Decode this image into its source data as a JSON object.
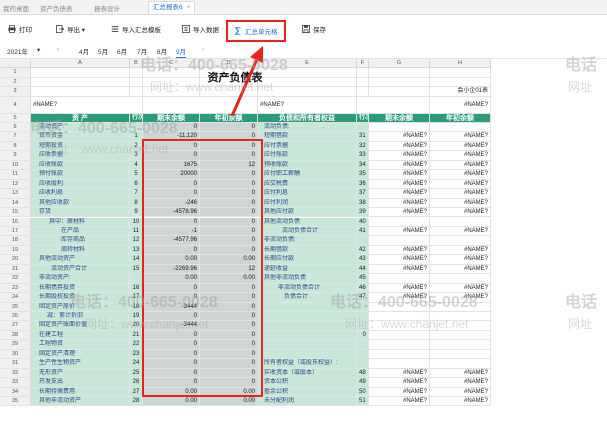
{
  "tabs": [
    "我的桌面",
    "资产负债表",
    "报表设计",
    "汇总报表6"
  ],
  "toolbar": {
    "print": "打印",
    "export": "导出",
    "import_template": "导入汇总模板",
    "import_data": "导入数据",
    "summarize_cells": "汇总单元格",
    "save": "保存"
  },
  "period": {
    "year": "2021年",
    "months": [
      "4月",
      "5月",
      "6月",
      "7月",
      "8月",
      "9月"
    ],
    "active_index": 5
  },
  "sheet": {
    "col_headers": [
      "A",
      "B",
      "C",
      "D",
      "E",
      "F",
      "G",
      "H"
    ],
    "title": "资产负债表",
    "unit": "会小企01表",
    "name_left": "#NAME?",
    "name_mid": "#NAME?",
    "name_right": "#NAME?",
    "header_left": [
      "资 产",
      "行次",
      "期末余额",
      "年初余额"
    ],
    "header_right": [
      "负债和所有者权益",
      "行次",
      "期末余额",
      "年初余额"
    ],
    "rows": [
      {
        "r": "6",
        "a": "流动资产:",
        "b": "",
        "c": "0",
        "d": "0",
        "e": "流动负债:",
        "f": "",
        "g": "",
        "h": ""
      },
      {
        "r": "7",
        "a": "货币资金",
        "b": "1",
        "c": "-11,120",
        "d": "0",
        "e": "短期借款",
        "f": "31",
        "g": "#NAME?",
        "h": "#NAME?"
      },
      {
        "r": "8",
        "a": "短期投资",
        "b": "2",
        "c": "0",
        "d": "0",
        "e": "应付票据",
        "f": "32",
        "g": "#NAME?",
        "h": "#NAME?"
      },
      {
        "r": "9",
        "a": "应收票据",
        "b": "3",
        "c": "0",
        "d": "0",
        "e": "应付账款",
        "f": "33",
        "g": "#NAME?",
        "h": "#NAME?"
      },
      {
        "r": "10",
        "a": "应收账款",
        "b": "4",
        "c": "1675",
        "d": "12",
        "e": "预收账款",
        "f": "34",
        "g": "#NAME?",
        "h": "#NAME?"
      },
      {
        "r": "11",
        "a": "预付账款",
        "b": "5",
        "c": "20000",
        "d": "0",
        "e": "应付职工薪酬",
        "f": "35",
        "g": "#NAME?",
        "h": "#NAME?"
      },
      {
        "r": "12",
        "a": "应收股利",
        "b": "6",
        "c": "0",
        "d": "0",
        "e": "应交税费",
        "f": "36",
        "g": "#NAME?",
        "h": "#NAME?"
      },
      {
        "r": "13",
        "a": "应收利息",
        "b": "7",
        "c": "0",
        "d": "0",
        "e": "应付利息",
        "f": "37",
        "g": "#NAME?",
        "h": "#NAME?"
      },
      {
        "r": "14",
        "a": "其他应收款",
        "b": "8",
        "c": "-246",
        "d": "0",
        "e": "应付利润",
        "f": "38",
        "g": "#NAME?",
        "h": "#NAME?"
      },
      {
        "r": "15",
        "a": "存货",
        "b": "9",
        "c": "-4578.96",
        "d": "0",
        "e": "其他应付款",
        "f": "39",
        "g": "#NAME?",
        "h": "#NAME?"
      },
      {
        "r": "16",
        "a": "其中：原材料",
        "b": "10",
        "c": "0",
        "d": "0",
        "e": "其他流动负债",
        "f": "40",
        "g": "",
        "h": ""
      },
      {
        "r": "17",
        "a": "在产品",
        "b": "11",
        "c": "-1",
        "d": "0",
        "e": "流动负债合计",
        "f": "41",
        "g": "#NAME?",
        "h": "#NAME?"
      },
      {
        "r": "18",
        "a": "库存商品",
        "b": "12",
        "c": "-4577.96",
        "d": "0",
        "e": "非流动负债:",
        "f": "",
        "g": "",
        "h": ""
      },
      {
        "r": "19",
        "a": "周转材料",
        "b": "13",
        "c": "0",
        "d": "0",
        "e": "长期借款",
        "f": "42",
        "g": "#NAME?",
        "h": "#NAME?"
      },
      {
        "r": "20",
        "a": "其他流动资产",
        "b": "14",
        "c": "0.00",
        "d": "0.00",
        "e": "长期应付款",
        "f": "43",
        "g": "#NAME?",
        "h": "#NAME?"
      },
      {
        "r": "21",
        "a": "流动资产合计",
        "b": "15",
        "c": "-2269.96",
        "d": "12",
        "e": "递延收益",
        "f": "44",
        "g": "#NAME?",
        "h": "#NAME?"
      },
      {
        "r": "22",
        "a": "非流动资产:",
        "b": "",
        "c": "0.00",
        "d": "0.00",
        "e": "其他非流动负债",
        "f": "45",
        "g": "",
        "h": ""
      },
      {
        "r": "23",
        "a": "长期债券投资",
        "b": "16",
        "c": "0",
        "d": "0",
        "e": "非流动负债合计",
        "f": "46",
        "g": "#NAME?",
        "h": "#NAME?"
      },
      {
        "r": "24",
        "a": "长期股权投资",
        "b": "17",
        "c": "0",
        "d": "0",
        "e": "负债合计",
        "f": "47",
        "g": "#NAME?",
        "h": "#NAME?"
      },
      {
        "r": "25",
        "a": "固定资产原价",
        "b": "18",
        "c": "-3444",
        "d": "0",
        "e": "",
        "f": "",
        "g": "",
        "h": ""
      },
      {
        "r": "26",
        "a": "减：累计折旧",
        "b": "19",
        "c": "0",
        "d": "0",
        "e": "",
        "f": "",
        "g": "",
        "h": ""
      },
      {
        "r": "27",
        "a": "固定资产账面价值",
        "b": "20",
        "c": "-3444",
        "d": "0",
        "e": "",
        "f": "",
        "g": "",
        "h": ""
      },
      {
        "r": "28",
        "a": "在建工程",
        "b": "21",
        "c": "0",
        "d": "0",
        "e": "",
        "f": "0",
        "g": "",
        "h": ""
      },
      {
        "r": "29",
        "a": "工程物资",
        "b": "22",
        "c": "0",
        "d": "0",
        "e": "",
        "f": "",
        "g": "",
        "h": ""
      },
      {
        "r": "30",
        "a": "固定资产清理",
        "b": "23",
        "c": "0",
        "d": "0",
        "e": "",
        "f": "",
        "g": "",
        "h": ""
      },
      {
        "r": "31",
        "a": "生产性生物资产",
        "b": "24",
        "c": "0",
        "d": "0",
        "e": "所有者权益（或股东权益）:",
        "f": "",
        "g": "",
        "h": ""
      },
      {
        "r": "32",
        "a": "无形资产",
        "b": "25",
        "c": "0",
        "d": "0",
        "e": "实收资本（或股本）",
        "f": "48",
        "g": "#NAME?",
        "h": "#NAME?"
      },
      {
        "r": "33",
        "a": "开发支出",
        "b": "26",
        "c": "0",
        "d": "0",
        "e": "资本公积",
        "f": "49",
        "g": "#NAME?",
        "h": "#NAME?"
      },
      {
        "r": "34",
        "a": "长期待摊费用",
        "b": "27",
        "c": "0.00",
        "d": "0.00",
        "e": "盈余公积",
        "f": "50",
        "g": "#NAME?",
        "h": "#NAME?"
      },
      {
        "r": "35",
        "a": "其他非流动资产",
        "b": "28",
        "c": "0.00",
        "d": "0.00",
        "e": "未分配利润",
        "f": "51",
        "g": "#NAME?",
        "h": "#NAME?"
      }
    ]
  },
  "watermarks": {
    "phone": "电话：400-665-0028",
    "web": "网址：www.chanjet.net",
    "short1": "电话",
    "short2": "网址"
  }
}
